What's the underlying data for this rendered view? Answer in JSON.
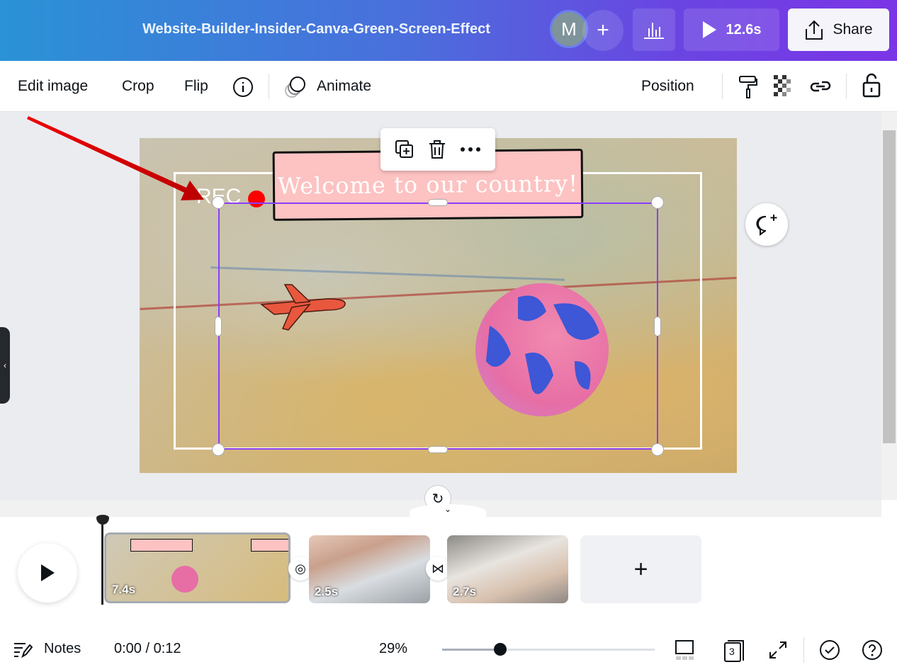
{
  "header": {
    "title": "Website-Builder-Insider-Canva-Green-Screen-Effect",
    "avatar_initial": "M",
    "add_icon": "plus-icon",
    "insights_icon": "bar-chart-icon",
    "present_duration": "12.6s",
    "share_label": "Share"
  },
  "toolbar": {
    "edit_image": "Edit image",
    "crop": "Crop",
    "flip": "Flip",
    "animate": "Animate",
    "position": "Position",
    "icons": [
      "info-icon",
      "animate-icon",
      "paint-roller-icon",
      "transparency-icon",
      "link-icon",
      "lock-icon"
    ]
  },
  "canvas": {
    "banner_text": "Welcome to our country!",
    "rec_text": "REC",
    "rec_color": "#ff0000",
    "selection_color": "#8b3dff",
    "floating_icons": [
      "duplicate-icon",
      "trash-icon",
      "more-icon"
    ]
  },
  "timeline": {
    "clips": [
      {
        "duration": "7.4s"
      },
      {
        "duration": "2.5s"
      },
      {
        "duration": "2.7s"
      }
    ],
    "transitions": [
      "dissolve-icon",
      "bowtie-icon"
    ],
    "add_label": "+"
  },
  "footer": {
    "notes": "Notes",
    "time": "0:00 / 0:12",
    "zoom": "29%",
    "zoom_value": 29,
    "page_count": "3"
  }
}
